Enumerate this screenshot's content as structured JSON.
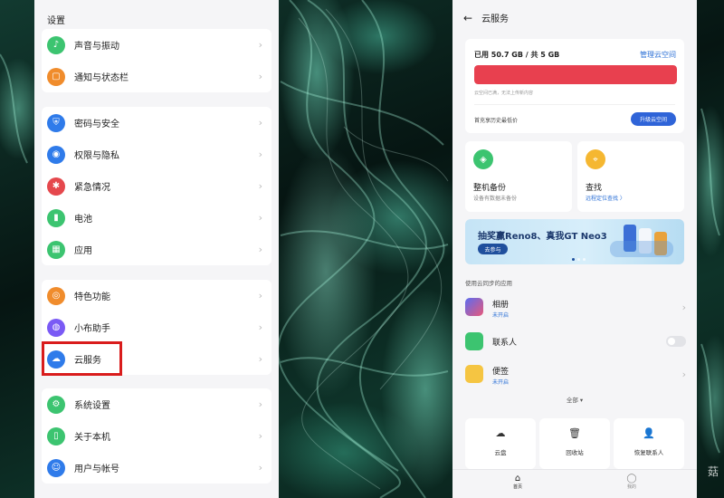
{
  "settings": {
    "title": "设置",
    "groups": [
      {
        "items": [
          {
            "label": "声音与振动",
            "icon": "bell-icon",
            "color": "#3cc470"
          },
          {
            "label": "通知与状态栏",
            "icon": "notification-icon",
            "color": "#f08c2c"
          }
        ]
      },
      {
        "items": [
          {
            "label": "密码与安全",
            "icon": "shield-icon",
            "color": "#2f7bea"
          },
          {
            "label": "权限与隐私",
            "icon": "privacy-eye-icon",
            "color": "#2f7bea"
          },
          {
            "label": "紧急情况",
            "icon": "emergency-asterisk-icon",
            "color": "#e5484d"
          },
          {
            "label": "电池",
            "icon": "battery-icon",
            "color": "#3cc470"
          },
          {
            "label": "应用",
            "icon": "apps-grid-icon",
            "color": "#3cc470"
          }
        ]
      },
      {
        "items": [
          {
            "label": "特色功能",
            "icon": "feature-star-icon",
            "color": "#f08c2c"
          },
          {
            "label": "小布助手",
            "icon": "assistant-icon",
            "color": "#7a5af5"
          },
          {
            "label": "云服务",
            "icon": "cloud-icon",
            "color": "#2f7bea"
          }
        ]
      },
      {
        "items": [
          {
            "label": "系统设置",
            "icon": "gear-icon",
            "color": "#3cc470"
          },
          {
            "label": "关于本机",
            "icon": "phone-icon",
            "color": "#3cc470"
          },
          {
            "label": "用户与帐号",
            "icon": "user-icon",
            "color": "#2f7bea"
          }
        ]
      }
    ],
    "highlight_color": "#d91c1c"
  },
  "cloud": {
    "title": "云服务",
    "storage": {
      "used_text": "已用 50.7 GB / 共 5 GB",
      "manage_label": "管理云空间",
      "used_fraction": 1.0,
      "warning": "云空间已满，无法上传新内容",
      "history_label": "首充享历史最低价",
      "upgrade_label": "升级云空间",
      "bar_color": "#e8404f"
    },
    "tiles": [
      {
        "title": "整机备份",
        "subtitle": "设备有数据未备份",
        "icon": "layers-icon",
        "color": "#3cc470"
      },
      {
        "title": "查找",
        "subtitle": "远程定位查找 〉",
        "icon": "location-pin-icon",
        "color": "#f5b731"
      }
    ],
    "banner": {
      "text": "抽奖赢Reno8、真我GT Neo3",
      "button": "去参与"
    },
    "apps_section_label": "使用云同步的应用",
    "apps": [
      {
        "name": "相册",
        "status": "未开启",
        "icon": "gallery-icon",
        "control": "chevron"
      },
      {
        "name": "联系人",
        "status": "",
        "icon": "contacts-icon",
        "control": "toggle"
      },
      {
        "name": "便签",
        "status": "未开启",
        "icon": "notes-icon",
        "control": "chevron"
      }
    ],
    "all_label": "全部 ▾",
    "bottom_tiles": [
      {
        "label": "云盘",
        "icon": "cloud-drive-icon",
        "glyph": "☁"
      },
      {
        "label": "回收站",
        "icon": "trash-icon",
        "glyph": "🗑"
      },
      {
        "label": "恢复联系人",
        "icon": "restore-contacts-icon",
        "glyph": "👤"
      }
    ],
    "nav": [
      {
        "label": "首页",
        "icon": "home-icon",
        "glyph": "⌂"
      },
      {
        "label": "我的",
        "icon": "profile-icon",
        "glyph": "◯"
      }
    ]
  },
  "watermark": "菇"
}
